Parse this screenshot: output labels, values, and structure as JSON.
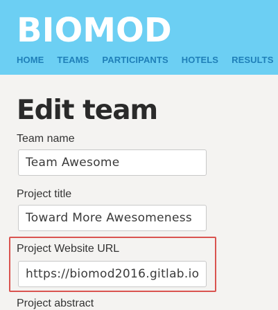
{
  "header": {
    "logo_text": "BIOMOD",
    "background_color": "#6ccff3",
    "nav": [
      {
        "label": "HOME"
      },
      {
        "label": "TEAMS"
      },
      {
        "label": "PARTICIPANTS"
      },
      {
        "label": "HOTELS"
      },
      {
        "label": "RESULTS"
      }
    ]
  },
  "main": {
    "title": "Edit team",
    "fields": [
      {
        "label": "Team name",
        "value": "Team Awesome"
      },
      {
        "label": "Project title",
        "value": "Toward More Awesomeness"
      },
      {
        "label": "Project Website URL",
        "value": "https://biomod2016.gitlab.io",
        "highlighted": true
      },
      {
        "label": "Project abstract"
      }
    ],
    "highlight_color": "#d9534f"
  }
}
